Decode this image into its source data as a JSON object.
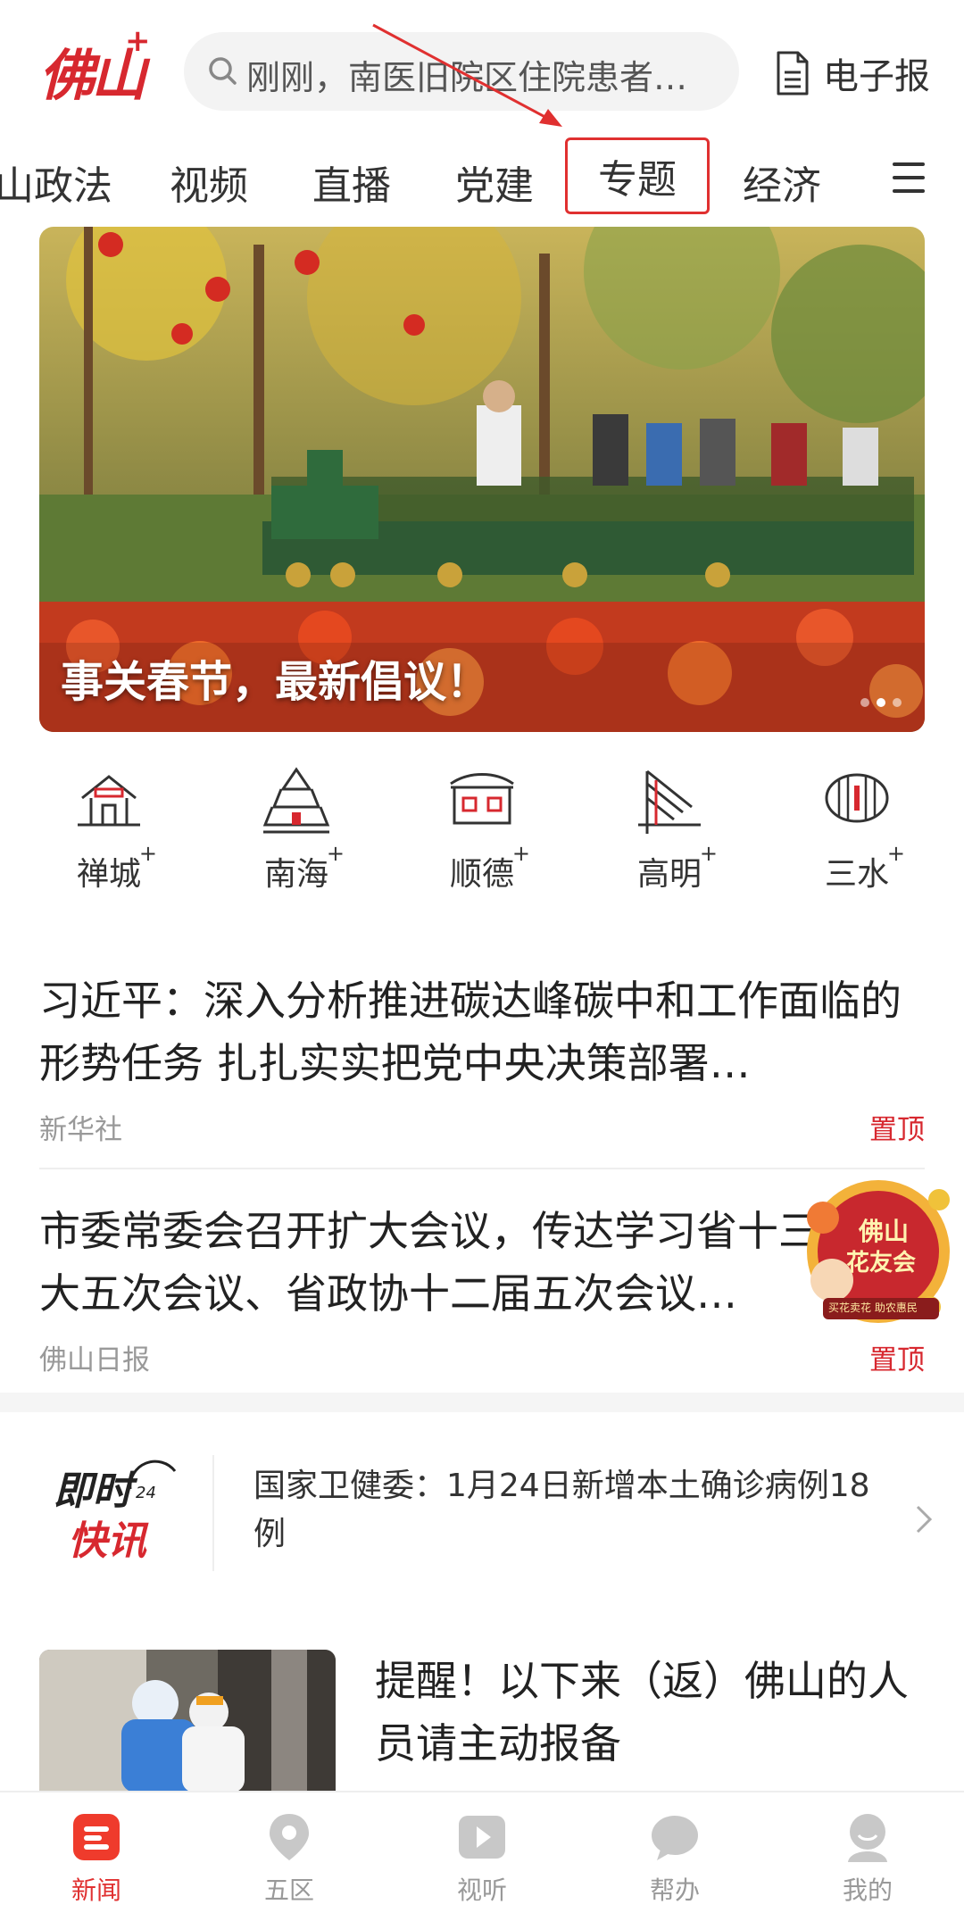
{
  "header": {
    "logo_text": "佛山",
    "logo_plus": "+",
    "search_placeholder": "刚刚，南医旧院区住院患者…",
    "epaper_label": "电子报"
  },
  "tabs": [
    "山政法",
    "视频",
    "直播",
    "党建",
    "专题",
    "经济"
  ],
  "banner": {
    "caption": "事关春节，最新倡议！",
    "slide_count": 3,
    "active_slide": 2
  },
  "districts": [
    {
      "label": "禅城",
      "plus": "+"
    },
    {
      "label": "南海",
      "plus": "+"
    },
    {
      "label": "顺德",
      "plus": "+"
    },
    {
      "label": "高明",
      "plus": "+"
    },
    {
      "label": "三水",
      "plus": "+"
    }
  ],
  "news": [
    {
      "title": "习近平：深入分析推进碳达峰碳中和工作面临的形势任务 扎扎实实把党中央决策部署…",
      "source": "新华社",
      "tag": "置顶"
    },
    {
      "title": "市委常委会召开扩大会议，传达学习省十三届人大五次会议、省政协十二届五次会议…",
      "source": "佛山日报",
      "tag": "置顶"
    }
  ],
  "float_badge": {
    "title_line1": "佛山",
    "title_line2": "花友会",
    "subtitle": "买花卖花 助农惠民"
  },
  "flash": {
    "logo_line1": "即时",
    "logo_sub": "24",
    "logo_line2": "快讯",
    "text": "国家卫健委：1月24日新增本土确诊病例18例"
  },
  "image_news": {
    "title": "提醒！以下来（返）佛山的人员请主动报备"
  },
  "bottom_nav": [
    {
      "label": "新闻",
      "active": true
    },
    {
      "label": "五区",
      "active": false
    },
    {
      "label": "视听",
      "active": false
    },
    {
      "label": "帮办",
      "active": false
    },
    {
      "label": "我的",
      "active": false
    }
  ],
  "colors": {
    "brand_red": "#d7282f",
    "annotation_red": "#e03030",
    "muted_text": "#999999"
  }
}
